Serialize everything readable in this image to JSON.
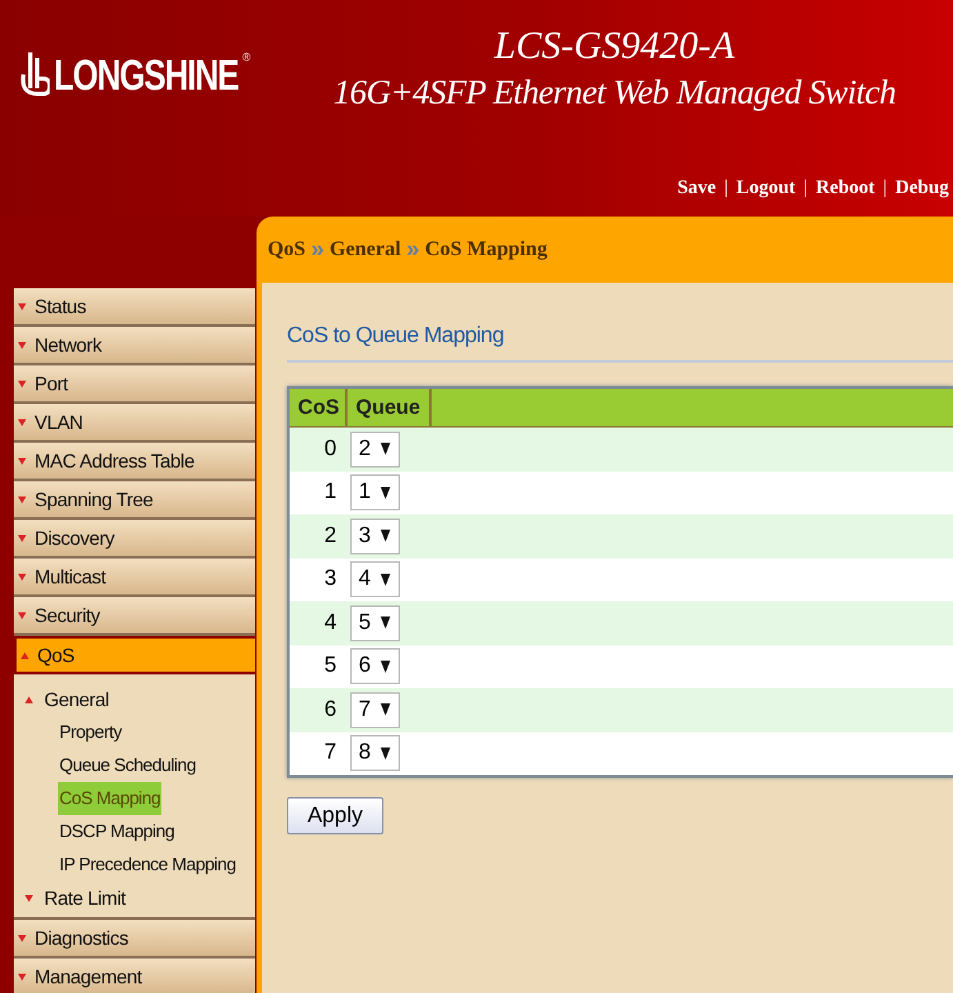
{
  "header": {
    "logo": {
      "text": "LONGSHINE",
      "mark": "®"
    },
    "title": "LCS-GS9420-A",
    "subtitle": "16G+4SFP Ethernet Web Managed Switch",
    "links": [
      {
        "kind": "link",
        "label": "Save"
      },
      {
        "kind": "separator",
        "label": "|"
      },
      {
        "kind": "link",
        "label": "Logout"
      },
      {
        "kind": "separator",
        "label": "|"
      },
      {
        "kind": "link",
        "label": "Reboot"
      },
      {
        "kind": "separator",
        "label": "|"
      },
      {
        "kind": "link",
        "label": "Debug"
      }
    ]
  },
  "breadcrumb": [
    {
      "kind": "crumb",
      "label": "QoS"
    },
    {
      "kind": "separator",
      "label": "»"
    },
    {
      "kind": "crumb",
      "label": "General"
    },
    {
      "kind": "separator",
      "label": "»"
    },
    {
      "kind": "crumb",
      "label": "CoS Mapping"
    }
  ],
  "sidebar": {
    "items": [
      {
        "label": "Status",
        "selected": false,
        "expanded": false
      },
      {
        "label": "Network",
        "selected": false,
        "expanded": false
      },
      {
        "label": "Port",
        "selected": false,
        "expanded": false
      },
      {
        "label": "VLAN",
        "selected": false,
        "expanded": false
      },
      {
        "label": "MAC Address Table",
        "selected": false,
        "expanded": false
      },
      {
        "label": "Spanning Tree",
        "selected": false,
        "expanded": false
      },
      {
        "label": "Discovery",
        "selected": false,
        "expanded": false
      },
      {
        "label": "Multicast",
        "selected": false,
        "expanded": false
      },
      {
        "label": "Security",
        "selected": false,
        "expanded": false
      },
      {
        "label": "QoS",
        "selected": true,
        "expanded": true,
        "children": [
          {
            "label": "General",
            "expanded": true,
            "children": [
              {
                "label": "Property",
                "selected": false
              },
              {
                "label": "Queue Scheduling",
                "selected": false
              },
              {
                "label": "CoS Mapping",
                "selected": true
              },
              {
                "label": "DSCP Mapping",
                "selected": false
              },
              {
                "label": "IP Precedence Mapping",
                "selected": false
              }
            ]
          },
          {
            "label": "Rate Limit",
            "expanded": false
          }
        ]
      },
      {
        "label": "Diagnostics",
        "selected": false,
        "expanded": false
      },
      {
        "label": "Management",
        "selected": false,
        "expanded": false
      }
    ]
  },
  "section": {
    "title": "CoS to Queue Mapping",
    "table": {
      "columns": [
        "CoS",
        "Queue"
      ],
      "rows": [
        {
          "cos": "0",
          "queue": "2"
        },
        {
          "cos": "1",
          "queue": "1"
        },
        {
          "cos": "2",
          "queue": "3"
        },
        {
          "cos": "3",
          "queue": "4"
        },
        {
          "cos": "4",
          "queue": "5"
        },
        {
          "cos": "5",
          "queue": "6"
        },
        {
          "cos": "6",
          "queue": "7"
        },
        {
          "cos": "7",
          "queue": "8"
        }
      ]
    },
    "buttons": [
      "Apply"
    ]
  }
}
